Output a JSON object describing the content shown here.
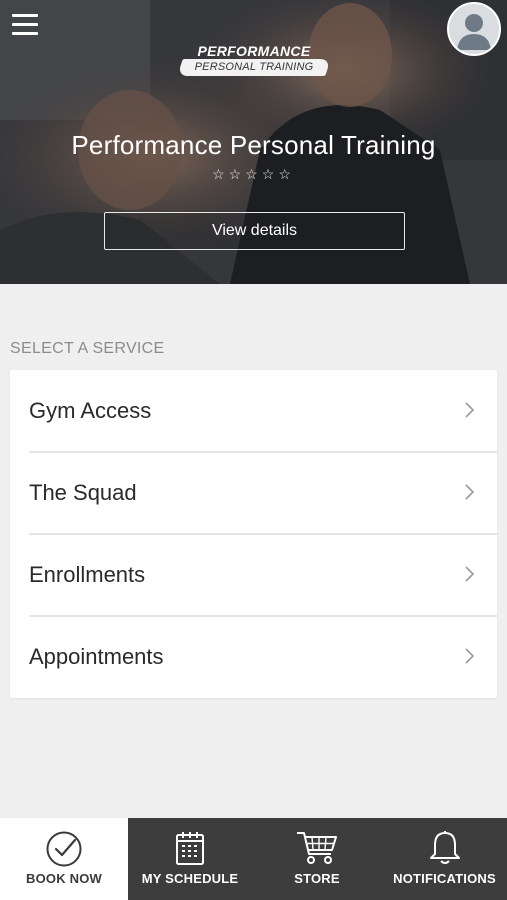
{
  "hero": {
    "logo_top": "PERFORMANCE",
    "logo_bottom": "PERSONAL TRAINING",
    "title": "Performance Personal Training",
    "stars": "☆☆☆☆☆",
    "view_details_label": "View details"
  },
  "services": {
    "section_label": "SELECT A SERVICE",
    "items": [
      {
        "label": "Gym Access"
      },
      {
        "label": "The Squad"
      },
      {
        "label": "Enrollments"
      },
      {
        "label": "Appointments"
      }
    ]
  },
  "bottom_nav": {
    "items": [
      {
        "label": "BOOK NOW",
        "icon": "checkmark-circle-icon",
        "active": true
      },
      {
        "label": "MY SCHEDULE",
        "icon": "calendar-icon",
        "active": false
      },
      {
        "label": "STORE",
        "icon": "cart-icon",
        "active": false
      },
      {
        "label": "NOTIFICATIONS",
        "icon": "bell-icon",
        "active": false
      }
    ]
  },
  "colors": {
    "nav_background": "#3d3d3d",
    "page_background": "#efefef",
    "active_tab_background": "#ffffff"
  }
}
